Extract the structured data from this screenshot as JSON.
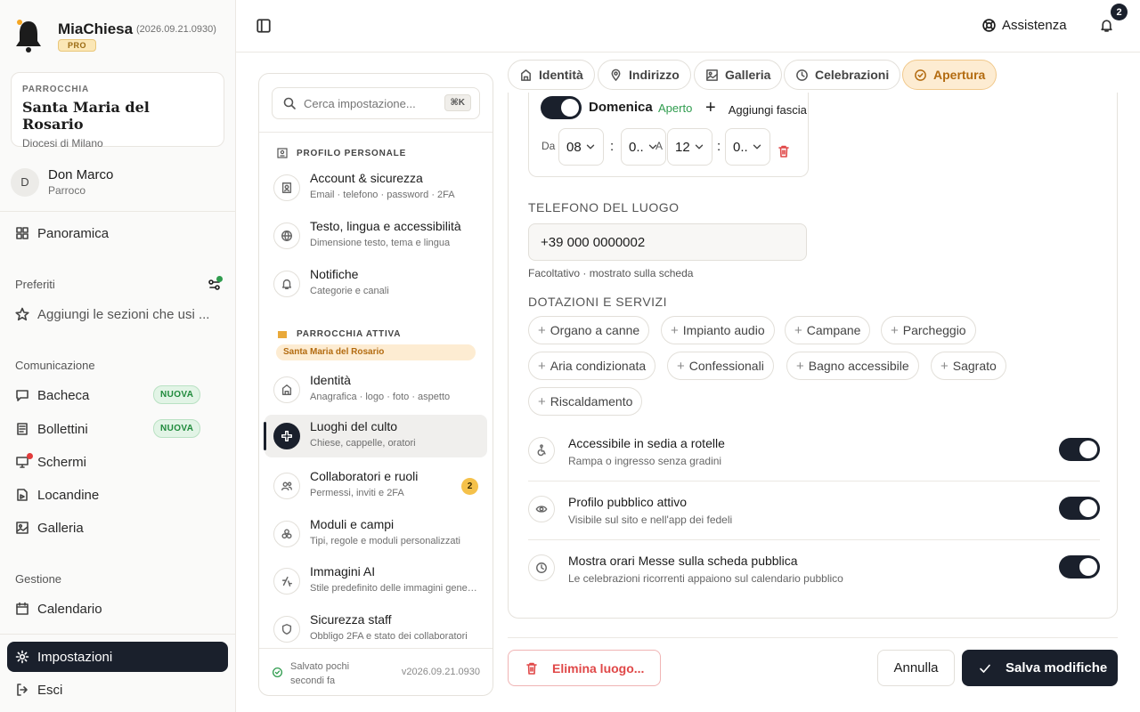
{
  "app": {
    "name": "MiaChiesa",
    "version": "(2026.09.21.0930)",
    "plan": "PRO"
  },
  "parish": {
    "label": "PARROCCHIA",
    "name": "Santa Maria del Rosario",
    "diocese": "Diocesi di Milano"
  },
  "user": {
    "initial": "D",
    "name": "Don Marco",
    "role": "Parroco"
  },
  "nav": {
    "overview": "Panoramica",
    "favorites": {
      "title": "Preferiti",
      "hint": "Aggiungi le sezioni che usi ..."
    },
    "communication": {
      "title": "Comunicazione",
      "items": [
        {
          "label": "Bacheca",
          "badge": "NUOVA"
        },
        {
          "label": "Bollettini",
          "badge": "NUOVA"
        },
        {
          "label": "Schermi"
        },
        {
          "label": "Locandine"
        },
        {
          "label": "Galleria"
        }
      ]
    },
    "management": {
      "title": "Gestione",
      "items": [
        {
          "label": "Calendario"
        }
      ]
    },
    "settings": "Impostazioni",
    "logout": "Esci"
  },
  "topbar": {
    "help": "Assistenza",
    "notification_count": "2"
  },
  "settings_panel": {
    "search": {
      "placeholder": "Cerca impostazione...",
      "shortcut": "⌘K"
    },
    "personal": {
      "title": "PROFILO PERSONALE",
      "items": [
        {
          "title": "Account & sicurezza",
          "subtitle": "Email · telefono · password · 2FA"
        },
        {
          "title": "Testo, lingua e accessibilità",
          "subtitle": "Dimensione testo, tema e lingua"
        },
        {
          "title": "Notifiche",
          "subtitle": "Categorie e canali"
        }
      ]
    },
    "parish": {
      "title": "PARROCCHIA ATTIVA",
      "active_name": "Santa Maria del Rosario",
      "items": [
        {
          "title": "Identità",
          "subtitle": "Anagrafica · logo · foto · aspetto"
        },
        {
          "title": "Luoghi del culto",
          "subtitle": "Chiese, cappelle, oratori"
        },
        {
          "title": "Collaboratori e ruoli",
          "subtitle": "Permessi, inviti e 2FA",
          "badge": "2"
        },
        {
          "title": "Moduli e campi",
          "subtitle": "Tipi, regole e moduli personalizzati"
        },
        {
          "title": "Immagini AI",
          "subtitle": "Stile predefinito delle immagini generate"
        },
        {
          "title": "Sicurezza staff",
          "subtitle": "Obbligo 2FA e stato dei collaboratori"
        }
      ]
    },
    "saved": {
      "line1": "Salvato pochi",
      "line2": "secondi fa"
    },
    "version": "v2026.09.21.0930"
  },
  "tabs": [
    {
      "label": "Identità",
      "icon": "building-icon"
    },
    {
      "label": "Indirizzo",
      "icon": "pin-icon"
    },
    {
      "label": "Galleria",
      "icon": "image-icon"
    },
    {
      "label": "Celebrazioni",
      "icon": "clock-icon"
    },
    {
      "label": "Apertura",
      "icon": "check-circle-icon",
      "active": true
    }
  ],
  "opening": {
    "day": "Domenica",
    "status": "Aperto",
    "add_slot": "Aggiungi fascia",
    "from_label": "Da",
    "to_label": "A",
    "from_hour": "08",
    "from_min": "0..",
    "to_hour": "12",
    "to_min": "0.."
  },
  "phone": {
    "label": "TELEFONO DEL LUOGO",
    "value": "+39 000 0000002",
    "hint": "Facoltativo · mostrato sulla scheda"
  },
  "amenities": {
    "label": "DOTAZIONI E SERVIZI",
    "chips": [
      "Organo a canne",
      "Impianto audio",
      "Campane",
      "Parcheggio",
      "Aria condizionata",
      "Confessionali",
      "Bagno accessibile",
      "Sagrato",
      "Riscaldamento"
    ]
  },
  "options": [
    {
      "title": "Accessibile in sedia a rotelle",
      "subtitle": "Rampa o ingresso senza gradini",
      "enabled": true
    },
    {
      "title": "Profilo pubblico attivo",
      "subtitle": "Visibile sul sito e nell'app dei fedeli",
      "enabled": true
    },
    {
      "title": "Mostra orari Messe sulla scheda pubblica",
      "subtitle": "Le celebrazioni ricorrenti appaiono sul calendario pubblico",
      "enabled": true
    }
  ],
  "actions": {
    "delete": "Elimina luogo...",
    "cancel": "Annulla",
    "save": "Salva modifiche"
  },
  "colors": {
    "primary": "#1a202c",
    "accent": "#b36b10",
    "success": "#2f9c4e",
    "danger": "#e04848"
  }
}
